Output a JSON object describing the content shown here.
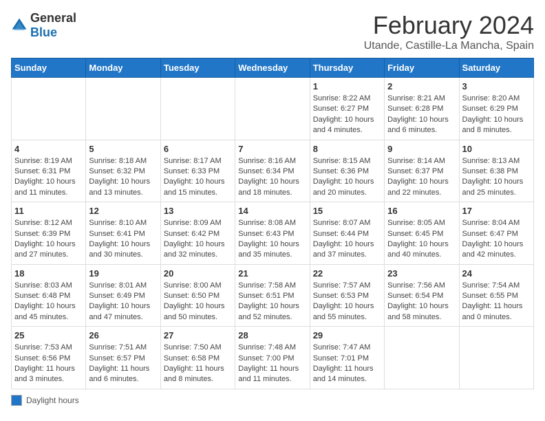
{
  "logo": {
    "general": "General",
    "blue": "Blue"
  },
  "title": "February 2024",
  "location": "Utande, Castille-La Mancha, Spain",
  "days_of_week": [
    "Sunday",
    "Monday",
    "Tuesday",
    "Wednesday",
    "Thursday",
    "Friday",
    "Saturday"
  ],
  "legend_label": "Daylight hours",
  "weeks": [
    [
      {
        "day": "",
        "info": ""
      },
      {
        "day": "",
        "info": ""
      },
      {
        "day": "",
        "info": ""
      },
      {
        "day": "",
        "info": ""
      },
      {
        "day": "1",
        "info": "Sunrise: 8:22 AM\nSunset: 6:27 PM\nDaylight: 10 hours\nand 4 minutes."
      },
      {
        "day": "2",
        "info": "Sunrise: 8:21 AM\nSunset: 6:28 PM\nDaylight: 10 hours\nand 6 minutes."
      },
      {
        "day": "3",
        "info": "Sunrise: 8:20 AM\nSunset: 6:29 PM\nDaylight: 10 hours\nand 8 minutes."
      }
    ],
    [
      {
        "day": "4",
        "info": "Sunrise: 8:19 AM\nSunset: 6:31 PM\nDaylight: 10 hours\nand 11 minutes."
      },
      {
        "day": "5",
        "info": "Sunrise: 8:18 AM\nSunset: 6:32 PM\nDaylight: 10 hours\nand 13 minutes."
      },
      {
        "day": "6",
        "info": "Sunrise: 8:17 AM\nSunset: 6:33 PM\nDaylight: 10 hours\nand 15 minutes."
      },
      {
        "day": "7",
        "info": "Sunrise: 8:16 AM\nSunset: 6:34 PM\nDaylight: 10 hours\nand 18 minutes."
      },
      {
        "day": "8",
        "info": "Sunrise: 8:15 AM\nSunset: 6:36 PM\nDaylight: 10 hours\nand 20 minutes."
      },
      {
        "day": "9",
        "info": "Sunrise: 8:14 AM\nSunset: 6:37 PM\nDaylight: 10 hours\nand 22 minutes."
      },
      {
        "day": "10",
        "info": "Sunrise: 8:13 AM\nSunset: 6:38 PM\nDaylight: 10 hours\nand 25 minutes."
      }
    ],
    [
      {
        "day": "11",
        "info": "Sunrise: 8:12 AM\nSunset: 6:39 PM\nDaylight: 10 hours\nand 27 minutes."
      },
      {
        "day": "12",
        "info": "Sunrise: 8:10 AM\nSunset: 6:41 PM\nDaylight: 10 hours\nand 30 minutes."
      },
      {
        "day": "13",
        "info": "Sunrise: 8:09 AM\nSunset: 6:42 PM\nDaylight: 10 hours\nand 32 minutes."
      },
      {
        "day": "14",
        "info": "Sunrise: 8:08 AM\nSunset: 6:43 PM\nDaylight: 10 hours\nand 35 minutes."
      },
      {
        "day": "15",
        "info": "Sunrise: 8:07 AM\nSunset: 6:44 PM\nDaylight: 10 hours\nand 37 minutes."
      },
      {
        "day": "16",
        "info": "Sunrise: 8:05 AM\nSunset: 6:45 PM\nDaylight: 10 hours\nand 40 minutes."
      },
      {
        "day": "17",
        "info": "Sunrise: 8:04 AM\nSunset: 6:47 PM\nDaylight: 10 hours\nand 42 minutes."
      }
    ],
    [
      {
        "day": "18",
        "info": "Sunrise: 8:03 AM\nSunset: 6:48 PM\nDaylight: 10 hours\nand 45 minutes."
      },
      {
        "day": "19",
        "info": "Sunrise: 8:01 AM\nSunset: 6:49 PM\nDaylight: 10 hours\nand 47 minutes."
      },
      {
        "day": "20",
        "info": "Sunrise: 8:00 AM\nSunset: 6:50 PM\nDaylight: 10 hours\nand 50 minutes."
      },
      {
        "day": "21",
        "info": "Sunrise: 7:58 AM\nSunset: 6:51 PM\nDaylight: 10 hours\nand 52 minutes."
      },
      {
        "day": "22",
        "info": "Sunrise: 7:57 AM\nSunset: 6:53 PM\nDaylight: 10 hours\nand 55 minutes."
      },
      {
        "day": "23",
        "info": "Sunrise: 7:56 AM\nSunset: 6:54 PM\nDaylight: 10 hours\nand 58 minutes."
      },
      {
        "day": "24",
        "info": "Sunrise: 7:54 AM\nSunset: 6:55 PM\nDaylight: 11 hours\nand 0 minutes."
      }
    ],
    [
      {
        "day": "25",
        "info": "Sunrise: 7:53 AM\nSunset: 6:56 PM\nDaylight: 11 hours\nand 3 minutes."
      },
      {
        "day": "26",
        "info": "Sunrise: 7:51 AM\nSunset: 6:57 PM\nDaylight: 11 hours\nand 6 minutes."
      },
      {
        "day": "27",
        "info": "Sunrise: 7:50 AM\nSunset: 6:58 PM\nDaylight: 11 hours\nand 8 minutes."
      },
      {
        "day": "28",
        "info": "Sunrise: 7:48 AM\nSunset: 7:00 PM\nDaylight: 11 hours\nand 11 minutes."
      },
      {
        "day": "29",
        "info": "Sunrise: 7:47 AM\nSunset: 7:01 PM\nDaylight: 11 hours\nand 14 minutes."
      },
      {
        "day": "",
        "info": ""
      },
      {
        "day": "",
        "info": ""
      }
    ]
  ]
}
